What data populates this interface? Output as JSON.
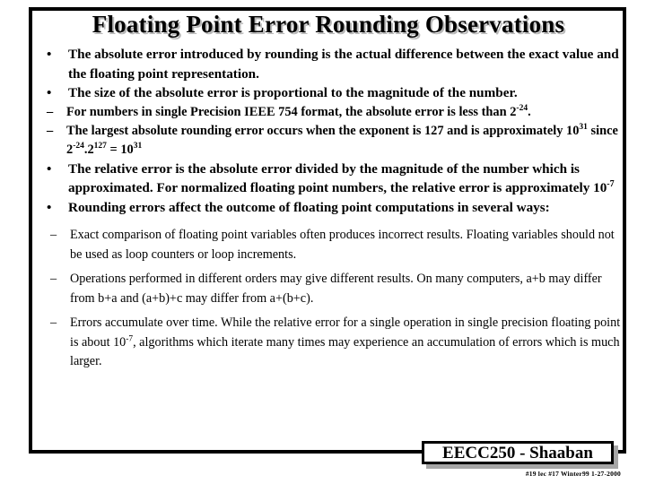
{
  "slide": {
    "title": "Floating Point Error Rounding Observations",
    "bullets": {
      "b1_absolute_error": "The absolute error introduced by rounding is the actual difference between the exact value and the floating point representation.",
      "b1_size_proportional": "The size of the absolute error is proportional to the magnitude of the number.",
      "b2_single_precision_pre": "For numbers in single Precision  IEEE 754 format, the absolute error is less than  2",
      "b2_single_precision_sup": "-24",
      "b2_single_precision_post": ".",
      "b2_largest_pre": "The largest absolute rounding error occurs when the exponent is 127 and is approximately 10",
      "b2_largest_sup1": "31",
      "b2_largest_mid1": " since   2",
      "b2_largest_sup2": "-24",
      "b2_largest_mid2": ".2",
      "b2_largest_sup3": "127",
      "b2_largest_mid3": " = 10",
      "b2_largest_sup4": "31",
      "b1_relative_pre": "The relative error is the absolute error divided by the magnitude of the number which is approximated.   For normalized floating point numbers, the relative error is approximately 10",
      "b1_relative_sup": "-7",
      "b1_rounding_affect": "Rounding errors affect the outcome of floating point computations in several ways:",
      "b2_exact_comparison": "Exact comparison of floating point variables often produces incorrect results. Floating variables should not be used as loop counters or loop increments.",
      "b2_operations_order": "Operations performed in different orders may give different results. On many computers,  a+b may differ from b+a and (a+b)+c may differ from a+(b+c).",
      "b2_accumulate_pre": "Errors accumulate over time. While the relative error for a single operation in single  precision floating point is about 10",
      "b2_accumulate_sup": "-7",
      "b2_accumulate_post": ", algorithms which iterate many times may experience an accumulation of errors which is much larger."
    },
    "markers": {
      "dot": "•",
      "dash": "–"
    }
  },
  "footer": {
    "badge_label": "EECC250 - Shaaban",
    "meta": "#19  lec #17  Winter99  1-27-2000"
  },
  "colors": {
    "background": "#ffffff",
    "text": "#000000",
    "frame": "#000000",
    "title_shadow": "#b8b8b8",
    "badge_shadow": "#a6a6a6"
  }
}
